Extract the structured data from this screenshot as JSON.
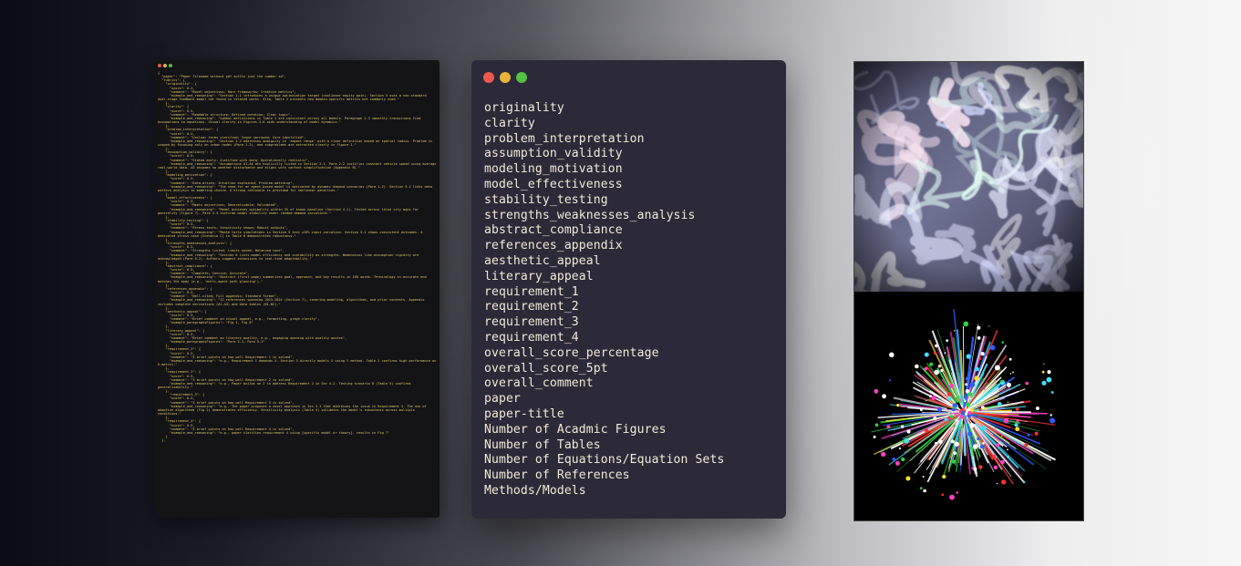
{
  "code_window": {
    "traffic_lights": [
      "#e25a4a",
      "#e2b13a",
      "#4fbd45"
    ],
    "code_text": "{\n  \"paper\": \"Paper Filename without pdf suffix just the number id\",\n  \"rubrics\": {\n    \"originality\": {\n      \"score\": 0-5,\n      \"comment\": \"Novel objectives; Rare frameworks; Creative metrics\",\n      \"example_and_reasoning\": \"Section 1.1 introduces a unique optimization target (nonlinear equity gain). Section 3 uses a non-standard dual-stage feedback model not found in related works. Also, Table 2 presents new domain-specific metrics not commonly used.\"\n    },\n    \"clarity\": {\n      \"score\": 0-5,\n      \"comment\": \"Readable structure; Defined notation; Clear logic\",\n      \"example_and_reasoning\": \"Symbol definitions in Table 1 are consistent across all models. Paragraph 2.3 smoothly transitions from assumptions to equations. Visual clarity in Figures 4-6 aids understanding of model dynamics.\"\n    },\n    \"problem_interpretation\": {\n      \"score\": 0-5,\n      \"comment\": \"Unclear terms clarified; Scope narrowed; Core identified\",\n      \"example_and_reasoning\": \"Section 1.2 addresses ambiguity in 'impact range' with a clear definition based on spatial radius. Problem is scoped by focusing only on urban nodes (Para 1.3), and subproblems are extracted clearly in Figure 1.\"\n    },\n    \"assumption_validity\": {\n      \"score\": 0-5,\n      \"comment\": \"Stated early; Justified with data; Operationally realistic\",\n      \"example_and_reasoning\": \"Assumptions A1-A4 are explicitly listed in Section 2.1. Para 2.2 justifies constant vehicle speed using average real-world data. A3 assumes no weather disturbance and aligns with context simplification (Appendix B).\"\n    },\n    \"modeling_motivation\": {\n      \"score\": 0-5,\n      \"comment\": \"Data-driven; Intuition explained; Problem-matching\",\n      \"example_and_reasoning\": \"The need for an agent-based model is motivated by dynamic demand scenarios (Para 1.2). Section 3.1 links data pattern analysis to modeling choice. A strong rationale is provided for nonlinear penalties.\"\n    },\n    \"model_effectiveness\": {\n      \"score\": 0-5,\n      \"comment\": \"Meets objectives; Generalizable; Validated\",\n      \"example_and_reasoning\": \"Model achieves optimality within 3% of known baseline (Section 4.1). Tested across three city maps for generality (Figure 7). Para 4.3 confirms model stability under random demand variations.\"\n    },\n    \"stability_testing\": {\n      \"score\": 0-5,\n      \"comment\": \"Stress tests; Sensitivity shown; Robust outputs\",\n      \"example_and_reasoning\": \"Monte Carlo simulations in Section 5 test ±20% input variation. Section 5.2 shows consistent outcomes. A dedicated stress case (Scenario C) in Table 6 demonstrates robustness.\"\n    },\n    \"strengths_weaknesses_analysis\": {\n      \"score\": 0-5,\n      \"comment\": \"Strengths listed; Limits noted; Balanced tone\",\n      \"example_and_reasoning\": \"Section 6 lists model efficiency and scalability as strengths. Weaknesses like assumption rigidity are acknowledged (Para 6.2). Authors suggest extensions to real-time adaptability.\"\n    },\n    \"abstract_compliance\": {\n      \"score\": 0-5,\n      \"comment\": \"Complete; Concise; Accurate\",\n      \"example_and_reasoning\": \"Abstract (first page) summarizes goal, approach, and key results in 180 words. Terminology is accurate and matches the body (e.g., 'multi-agent path planning').\"\n    },\n    \"references_appendix\": {\n      \"score\": 0-5,\n      \"comment\": \"Well-cited; Full appendix; Standard format\",\n      \"example_and_reasoning\": \"12 references spanning 2015-2024 (Section 7), covering modeling, algorithms, and prior contests. Appendix includes complete derivations (A1-A3) and data tables (B1-B2).\"\n    },\n    \"aesthetic_appeal\": {\n      \"score\": 0-5,\n      \"comment\": \"Brief comment on visual appeal, e.g., formatting, graph clarity\",\n      \"example_paragraphsFigures\": \"Fig 1, Fig 6\"\n    },\n    \"literary_appeal\": {\n      \"score\": 0-5,\n      \"comment\": \"Brief comment on literary quality, e.g., engaging opening with quality quotes\",\n      \"example_paragraphsFigures\": \"Para 2.3, Para 5.1\"\n    },\n    \"requirement_1\": {\n      \"score\": 0-5,\n      \"comment\": \"3 brief points on how well Requirement 1 is solved\",\n      \"example_and_reasoning\": \"e.g., Requirement 1 demands X. Section 3 directly models X using Y method. Table 2 confirms high performance on X-metric.\"\n    },\n    \"requirement_2\": {\n      \"score\": 0-5,\n      \"comment\": \"3 brief points on how well Requirement 2 is solved\",\n      \"example_and_reasoning\": \"e.g., Paper builds on 2 to address Requirement 2 in Sec 4.2. Testing scenario B (Table 5) confirms generalizability.\"\n    },\n      \"requirement_3\": {\n      \"score\": 0-5,\n      \"comment\": \"3 brief points on how well Requirement 3 is solved\",\n      \"example_and_reasoning\": \"e.g., The paper proposes a novel approach in Sec 3.1 that addresses the issue in Requirement 3. The use of adaptive algorithms (Fig 2) demonstrates efficiency. Sensitivity analysis (Table 4) validates the model's robustness across multiple conditions.\"\n    },\n    \"requirement_4\": {\n      \"score\": 0-5,\n      \"comment\": \"3 brief points on how well Requirement 4 is solved\",\n      \"example_and_reasoning\": \"e.g., paper clarifies requirement 4 using [specific model or theory], results in Fig 7\"\n    }\n  },"
  },
  "fields_window": {
    "traffic_lights": [
      "#ea5a50",
      "#e9b33c",
      "#52c144"
    ],
    "fields": [
      "originality",
      "clarity",
      "problem_interpretation",
      "assumption_validity",
      "modeling_motivation",
      "model_effectiveness",
      "stability_testing",
      "strengths_weaknesses_analysis",
      "abstract_compliance",
      "references_appendix",
      "aesthetic_appeal",
      "literary_appeal",
      "requirement_1",
      "requirement_2",
      "requirement_3",
      "requirement_4",
      "overall_score_percentage",
      "overall_score_5pt",
      "overall_comment",
      "paper",
      "paper-title",
      "Number of Acadmic Figures",
      "Number of Tables",
      "Number of Equations/Equation Sets",
      "Number of References",
      "Methods/Models"
    ]
  },
  "image_panel": {
    "top_image": "iridescent-caustic-texture",
    "bottom_image": "colorful-particle-splatter"
  }
}
